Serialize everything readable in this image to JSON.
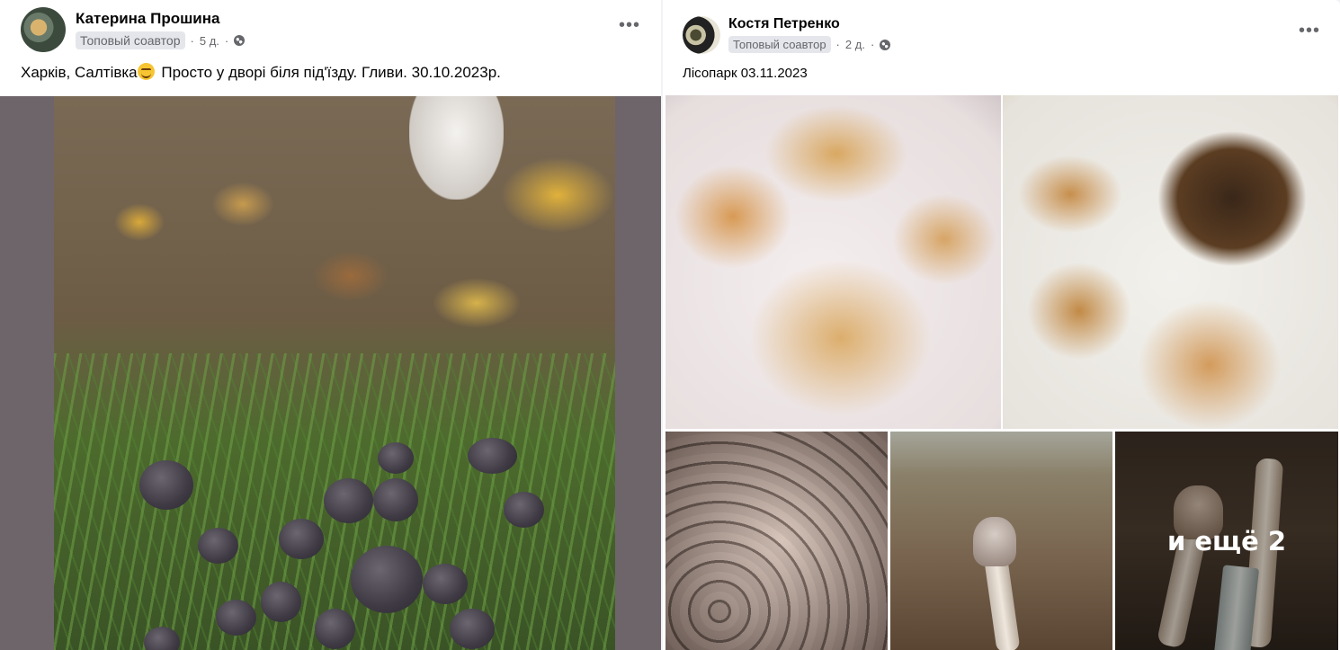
{
  "posts": [
    {
      "author": "Катерина Прошина",
      "badge": "Топовый соавтор",
      "separator": "·",
      "time": "5 д.",
      "text_before_emoji": "Харків, Салтівка",
      "text_after_emoji": " Просто у дворі біля під'їзду. Гливи. 30.10.2023р.",
      "more_icon": "•••"
    },
    {
      "author": "Костя Петренко",
      "badge": "Топовый соавтор",
      "separator": "·",
      "time": "2 д.",
      "text": "Лісопарк 03.11.2023",
      "more_icon": "•••",
      "more_photos_label": "и ещё 2"
    }
  ]
}
